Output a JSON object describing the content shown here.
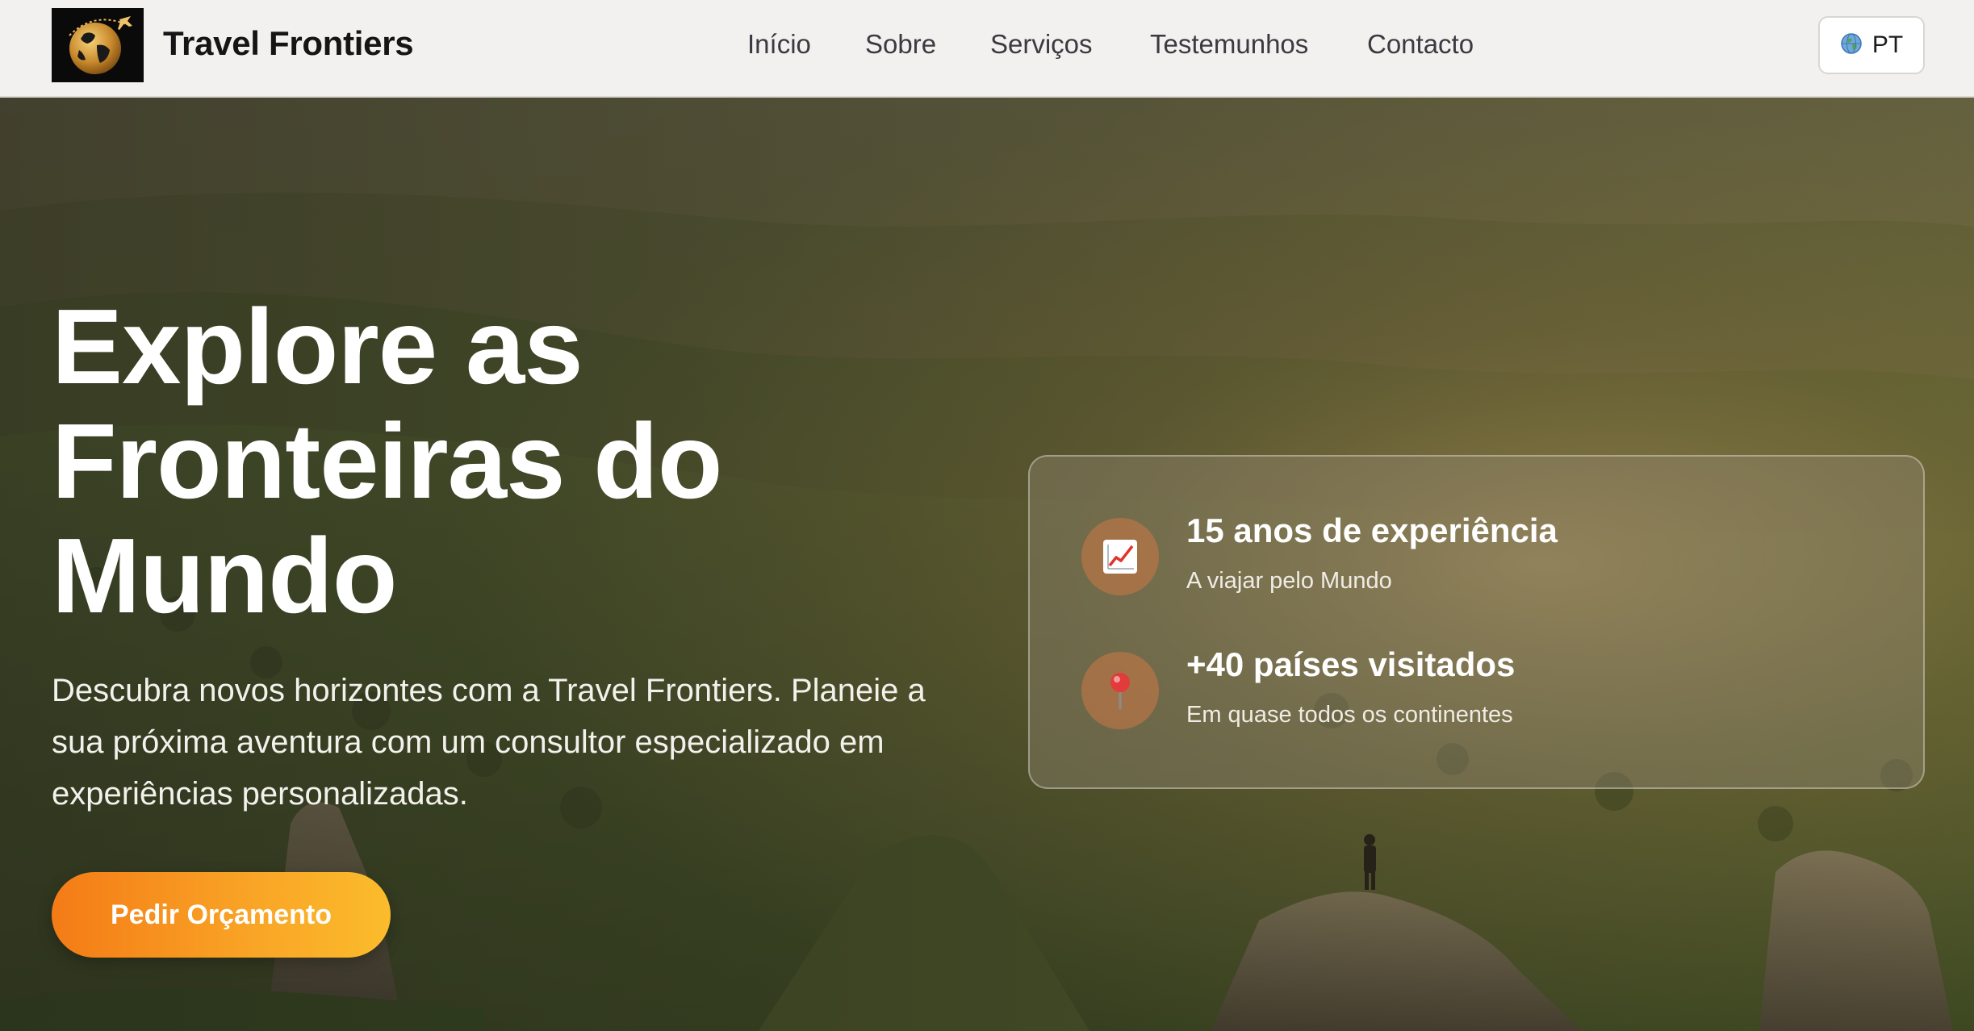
{
  "header": {
    "brand": "Travel Frontiers",
    "logo_icon": "globe-airplane-logo",
    "nav": [
      {
        "label": "Início"
      },
      {
        "label": "Sobre"
      },
      {
        "label": "Serviços"
      },
      {
        "label": "Testemunhos"
      },
      {
        "label": "Contacto"
      }
    ],
    "language": {
      "icon": "globe-icon",
      "label": "PT"
    }
  },
  "hero": {
    "title_lines": [
      "Explore as",
      "Fronteiras do",
      "Mundo"
    ],
    "description": "Descubra novos horizontes com a Travel Frontiers. Planeie a sua próxima aventura com um consultor especializado em experiências personalizadas.",
    "cta_label": "Pedir Orçamento",
    "stats": [
      {
        "icon": "chart-increasing-icon",
        "title": "15 anos de experiência",
        "subtitle": "A viajar pelo Mundo"
      },
      {
        "icon": "pushpin-icon",
        "title": "+40 países visitados",
        "subtitle": "Em quase todos os continentes"
      }
    ]
  },
  "colors": {
    "accent_start": "#f47b16",
    "accent_end": "#fbbc2c",
    "header_bg": "#f2f1ef"
  }
}
